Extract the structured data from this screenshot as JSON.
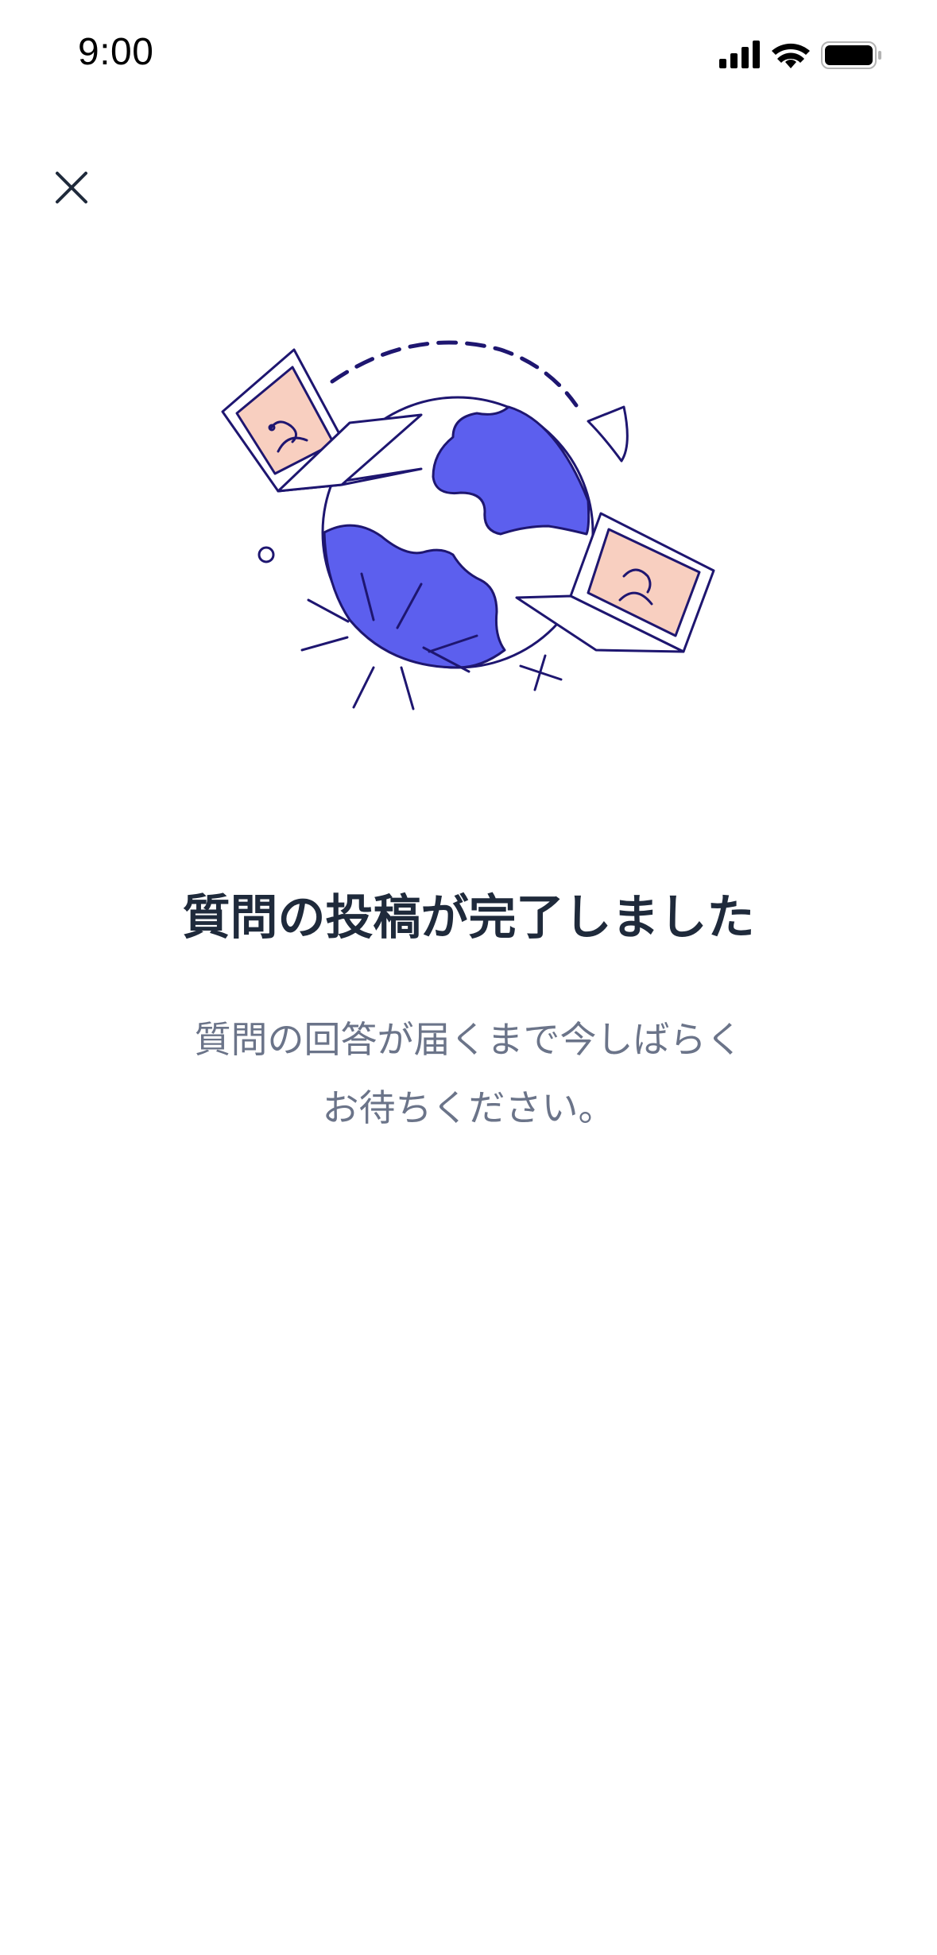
{
  "status_bar": {
    "time": "9:00",
    "icons": [
      "cellular-signal-icon",
      "wifi-icon",
      "battery-icon"
    ]
  },
  "header": {
    "close_icon": "close-icon"
  },
  "illustration": {
    "description_icon": "globe-with-sad-laptops-illustration",
    "colors": {
      "stroke": "#1e1670",
      "land": "#5c5fee",
      "screen": "#f8cfc0",
      "background": "#ffffff"
    }
  },
  "main": {
    "title": "質問の投稿が完了しました",
    "message_line1": "質問の回答が届くまで今しばらく",
    "message_line2": "お待ちください。"
  },
  "colors": {
    "title_text": "#1f2a3b",
    "body_text": "#6b7489"
  }
}
